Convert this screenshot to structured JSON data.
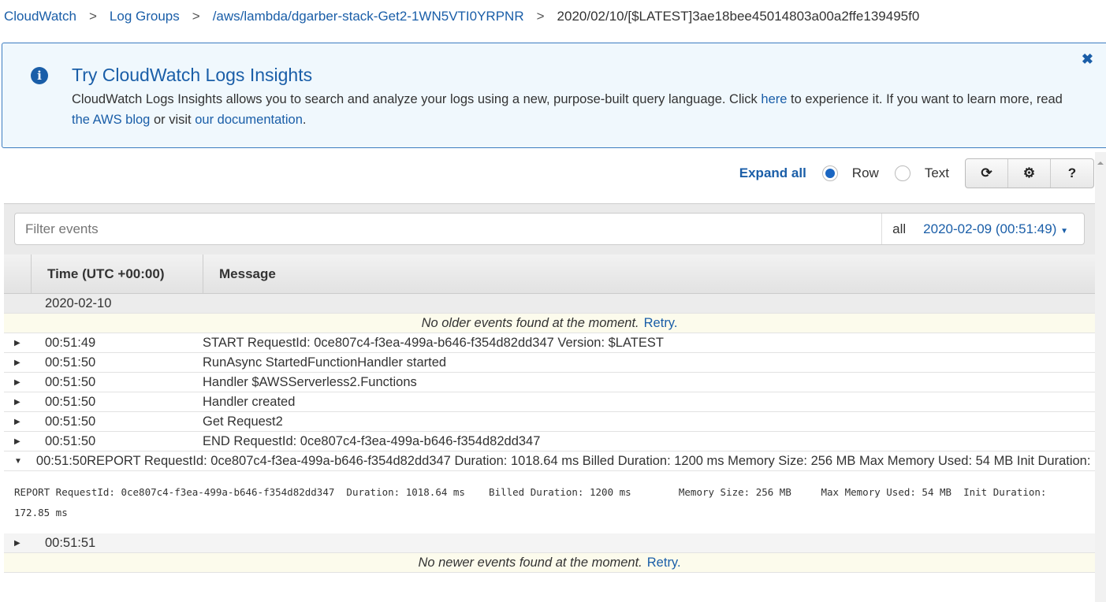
{
  "breadcrumb": [
    "CloudWatch",
    "Log Groups",
    "/aws/lambda/dgarber-stack-Get2-1WN5VTI0YRPNR",
    "2020/02/10/[$LATEST]3ae18bee45014803a00a2ffe139495f0"
  ],
  "banner": {
    "title": "Try CloudWatch Logs Insights",
    "t1": "CloudWatch Logs Insights allows you to search and analyze your logs using a new, purpose-built query language. Click ",
    "l1": "here",
    "t2": " to experience it. If you want to learn more, read ",
    "l2": "the AWS blog",
    "t3": " or visit ",
    "l3": "our documentation",
    "t4": "."
  },
  "toolbar": {
    "expand_all": "Expand all",
    "row": "Row",
    "text": "Text",
    "view_mode": "Row"
  },
  "filter": {
    "placeholder": "Filter events",
    "all": "all",
    "range": "2020-02-09 (00:51:49)"
  },
  "table": {
    "col_time": "Time (UTC +00:00)",
    "col_message": "Message",
    "date": "2020-02-10",
    "older": "No older events found at the moment.",
    "newer": "No newer events found at the moment.",
    "retry": "Retry.",
    "rows": [
      {
        "time": "00:51:49",
        "msg": "START RequestId: 0ce807c4-f3ea-499a-b646-f354d82dd347 Version: $LATEST"
      },
      {
        "time": "00:51:50",
        "msg": "RunAsync StartedFunctionHandler started"
      },
      {
        "time": "00:51:50",
        "msg": "Handler $AWSServerless2.Functions"
      },
      {
        "time": "00:51:50",
        "msg": "Handler created"
      },
      {
        "time": "00:51:50",
        "msg": "Get Request2"
      },
      {
        "time": "00:51:50",
        "msg": "END RequestId: 0ce807c4-f3ea-499a-b646-f354d82dd347"
      },
      {
        "time": "00:51:50",
        "msg": "REPORT RequestId: 0ce807c4-f3ea-499a-b646-f354d82dd347 Duration: 1018.64 ms Billed Duration: 1200 ms Memory Size: 256 MB Max Memory Used: 54 MB Init Duration: 172.85 ms"
      }
    ],
    "detail": "REPORT RequestId: 0ce807c4-f3ea-499a-b646-f354d82dd347  Duration: 1018.64 ms    Billed Duration: 1200 ms        Memory Size: 256 MB     Max Memory Used: 54 MB  Init Duration: 172.85 ms",
    "last_time": "00:51:51"
  }
}
